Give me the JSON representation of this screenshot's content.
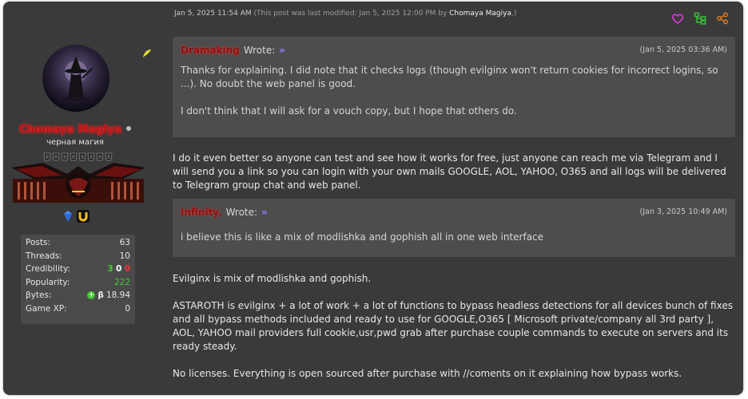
{
  "post": {
    "date": "Jan 5, 2025 11:54 AM",
    "modified_prefix": "(This post was last modified: Jan 5, 2025 12:00 PM by",
    "modified_by": "Chomaya Magiya",
    "modified_suffix": ".)"
  },
  "actions": [
    {
      "name": "like-icon",
      "color": "#d63ad6"
    },
    {
      "name": "thread-icon",
      "color": "#3ac23a"
    },
    {
      "name": "share-icon",
      "color": "#e07a22"
    }
  ],
  "author": {
    "username": "Chomaya Magiya",
    "title": "черная магия",
    "stars": 8,
    "stats": {
      "posts_label": "Posts:",
      "posts": "63",
      "threads_label": "Threads:",
      "threads": "10",
      "credibility_label": "Credibility:",
      "cred_pos": "3",
      "cred_neu": "0",
      "cred_neg": "0",
      "popularity_label": "Popularity:",
      "popularity": "222",
      "bytes_label": "βytes:",
      "bytes_symbol": "β",
      "bytes": "18.94",
      "gamexp_label": "Game XP:",
      "gamexp": "0"
    }
  },
  "quote1": {
    "name": "Dramaking",
    "wrote": "Wrote:",
    "arrow": "»",
    "date": "(Jan 5, 2025 03:36 AM)",
    "para1": "Thanks for explaining. I did note that it checks logs (though evilginx won't return cookies for incorrect logins, so ...). No doubt the web panel is good.",
    "para2": "I don't think that I will ask for a vouch copy, but I hope that others do."
  },
  "reply1": "I do it even better so anyone can test and see how it works for free, just anyone can reach me via Telegram and I will send you a link so you can login with your own mails GOOGLE, AOL, YAHOO, O365 and all logs will be delivered to Telegram group chat and web panel.",
  "quote2": {
    "name": "Infinity.",
    "wrote": "Wrote:",
    "arrow": "»",
    "date": "(Jan 3, 2025 10:49 AM)",
    "para1": "i believe this is like a mix of modlishka and gophish all in one web interface"
  },
  "reply2": {
    "para1": "Evilginx is mix of modlishka and gophish.",
    "para2": "ASTAROTH is evilginx + a lot of work + a lot of functions to bypass headless detections for all devices bunch of fixes and all bypass methods included and ready to use for GOOGLE,O365 [ Microsoft private/company all 3rd party ], AOL, YAHOO mail providers full cookie,usr,pwd grab after purchase couple commands to execute on servers and its ready steady.",
    "para3": "No licenses. Everything is open sourced after purchase with //coments on it explaining how bypass works."
  }
}
